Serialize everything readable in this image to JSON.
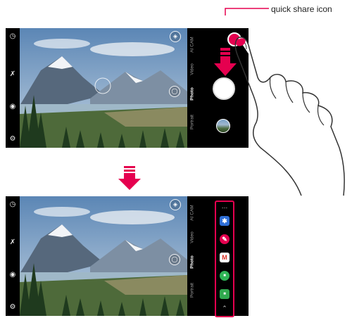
{
  "callout": {
    "label": "quick share icon",
    "accent": "#e5004f"
  },
  "camera": {
    "modes": [
      "Portrait",
      "Photo",
      "Video",
      "AI CAM"
    ],
    "selected_mode": "Photo"
  },
  "quick_share": {
    "more_label": "…",
    "apps": [
      {
        "name": "bluetooth-icon",
        "glyph": "✱",
        "color": "#2f6fd6"
      },
      {
        "name": "pencil-icon",
        "glyph": "✎",
        "color": "#e5004f"
      },
      {
        "name": "gmail-icon",
        "glyph": "M",
        "color": "#ffffff"
      },
      {
        "name": "messages-icon",
        "glyph": "■",
        "color": "#2fb556"
      },
      {
        "name": "hangouts-icon",
        "glyph": "■",
        "color": "#31a94f"
      }
    ],
    "collapse_label": "⌃"
  }
}
